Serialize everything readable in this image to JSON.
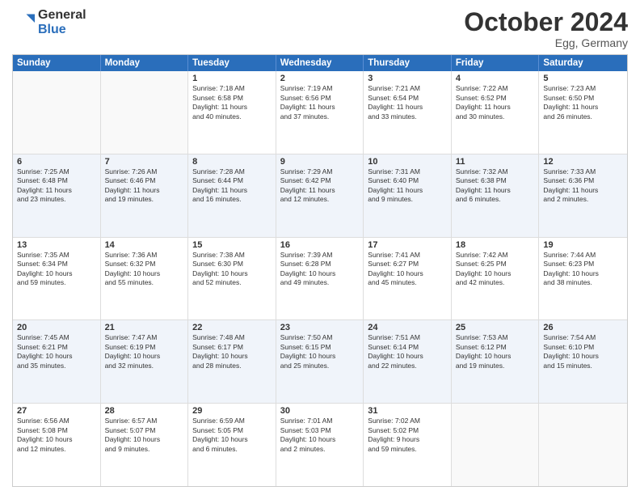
{
  "header": {
    "logo_general": "General",
    "logo_blue": "Blue",
    "month_title": "October 2024",
    "subtitle": "Egg, Germany"
  },
  "calendar": {
    "days_of_week": [
      "Sunday",
      "Monday",
      "Tuesday",
      "Wednesday",
      "Thursday",
      "Friday",
      "Saturday"
    ],
    "rows": [
      [
        {
          "day": "",
          "lines": []
        },
        {
          "day": "",
          "lines": []
        },
        {
          "day": "1",
          "lines": [
            "Sunrise: 7:18 AM",
            "Sunset: 6:58 PM",
            "Daylight: 11 hours",
            "and 40 minutes."
          ]
        },
        {
          "day": "2",
          "lines": [
            "Sunrise: 7:19 AM",
            "Sunset: 6:56 PM",
            "Daylight: 11 hours",
            "and 37 minutes."
          ]
        },
        {
          "day": "3",
          "lines": [
            "Sunrise: 7:21 AM",
            "Sunset: 6:54 PM",
            "Daylight: 11 hours",
            "and 33 minutes."
          ]
        },
        {
          "day": "4",
          "lines": [
            "Sunrise: 7:22 AM",
            "Sunset: 6:52 PM",
            "Daylight: 11 hours",
            "and 30 minutes."
          ]
        },
        {
          "day": "5",
          "lines": [
            "Sunrise: 7:23 AM",
            "Sunset: 6:50 PM",
            "Daylight: 11 hours",
            "and 26 minutes."
          ]
        }
      ],
      [
        {
          "day": "6",
          "lines": [
            "Sunrise: 7:25 AM",
            "Sunset: 6:48 PM",
            "Daylight: 11 hours",
            "and 23 minutes."
          ]
        },
        {
          "day": "7",
          "lines": [
            "Sunrise: 7:26 AM",
            "Sunset: 6:46 PM",
            "Daylight: 11 hours",
            "and 19 minutes."
          ]
        },
        {
          "day": "8",
          "lines": [
            "Sunrise: 7:28 AM",
            "Sunset: 6:44 PM",
            "Daylight: 11 hours",
            "and 16 minutes."
          ]
        },
        {
          "day": "9",
          "lines": [
            "Sunrise: 7:29 AM",
            "Sunset: 6:42 PM",
            "Daylight: 11 hours",
            "and 12 minutes."
          ]
        },
        {
          "day": "10",
          "lines": [
            "Sunrise: 7:31 AM",
            "Sunset: 6:40 PM",
            "Daylight: 11 hours",
            "and 9 minutes."
          ]
        },
        {
          "day": "11",
          "lines": [
            "Sunrise: 7:32 AM",
            "Sunset: 6:38 PM",
            "Daylight: 11 hours",
            "and 6 minutes."
          ]
        },
        {
          "day": "12",
          "lines": [
            "Sunrise: 7:33 AM",
            "Sunset: 6:36 PM",
            "Daylight: 11 hours",
            "and 2 minutes."
          ]
        }
      ],
      [
        {
          "day": "13",
          "lines": [
            "Sunrise: 7:35 AM",
            "Sunset: 6:34 PM",
            "Daylight: 10 hours",
            "and 59 minutes."
          ]
        },
        {
          "day": "14",
          "lines": [
            "Sunrise: 7:36 AM",
            "Sunset: 6:32 PM",
            "Daylight: 10 hours",
            "and 55 minutes."
          ]
        },
        {
          "day": "15",
          "lines": [
            "Sunrise: 7:38 AM",
            "Sunset: 6:30 PM",
            "Daylight: 10 hours",
            "and 52 minutes."
          ]
        },
        {
          "day": "16",
          "lines": [
            "Sunrise: 7:39 AM",
            "Sunset: 6:28 PM",
            "Daylight: 10 hours",
            "and 49 minutes."
          ]
        },
        {
          "day": "17",
          "lines": [
            "Sunrise: 7:41 AM",
            "Sunset: 6:27 PM",
            "Daylight: 10 hours",
            "and 45 minutes."
          ]
        },
        {
          "day": "18",
          "lines": [
            "Sunrise: 7:42 AM",
            "Sunset: 6:25 PM",
            "Daylight: 10 hours",
            "and 42 minutes."
          ]
        },
        {
          "day": "19",
          "lines": [
            "Sunrise: 7:44 AM",
            "Sunset: 6:23 PM",
            "Daylight: 10 hours",
            "and 38 minutes."
          ]
        }
      ],
      [
        {
          "day": "20",
          "lines": [
            "Sunrise: 7:45 AM",
            "Sunset: 6:21 PM",
            "Daylight: 10 hours",
            "and 35 minutes."
          ]
        },
        {
          "day": "21",
          "lines": [
            "Sunrise: 7:47 AM",
            "Sunset: 6:19 PM",
            "Daylight: 10 hours",
            "and 32 minutes."
          ]
        },
        {
          "day": "22",
          "lines": [
            "Sunrise: 7:48 AM",
            "Sunset: 6:17 PM",
            "Daylight: 10 hours",
            "and 28 minutes."
          ]
        },
        {
          "day": "23",
          "lines": [
            "Sunrise: 7:50 AM",
            "Sunset: 6:15 PM",
            "Daylight: 10 hours",
            "and 25 minutes."
          ]
        },
        {
          "day": "24",
          "lines": [
            "Sunrise: 7:51 AM",
            "Sunset: 6:14 PM",
            "Daylight: 10 hours",
            "and 22 minutes."
          ]
        },
        {
          "day": "25",
          "lines": [
            "Sunrise: 7:53 AM",
            "Sunset: 6:12 PM",
            "Daylight: 10 hours",
            "and 19 minutes."
          ]
        },
        {
          "day": "26",
          "lines": [
            "Sunrise: 7:54 AM",
            "Sunset: 6:10 PM",
            "Daylight: 10 hours",
            "and 15 minutes."
          ]
        }
      ],
      [
        {
          "day": "27",
          "lines": [
            "Sunrise: 6:56 AM",
            "Sunset: 5:08 PM",
            "Daylight: 10 hours",
            "and 12 minutes."
          ]
        },
        {
          "day": "28",
          "lines": [
            "Sunrise: 6:57 AM",
            "Sunset: 5:07 PM",
            "Daylight: 10 hours",
            "and 9 minutes."
          ]
        },
        {
          "day": "29",
          "lines": [
            "Sunrise: 6:59 AM",
            "Sunset: 5:05 PM",
            "Daylight: 10 hours",
            "and 6 minutes."
          ]
        },
        {
          "day": "30",
          "lines": [
            "Sunrise: 7:01 AM",
            "Sunset: 5:03 PM",
            "Daylight: 10 hours",
            "and 2 minutes."
          ]
        },
        {
          "day": "31",
          "lines": [
            "Sunrise: 7:02 AM",
            "Sunset: 5:02 PM",
            "Daylight: 9 hours",
            "and 59 minutes."
          ]
        },
        {
          "day": "",
          "lines": []
        },
        {
          "day": "",
          "lines": []
        }
      ]
    ]
  }
}
